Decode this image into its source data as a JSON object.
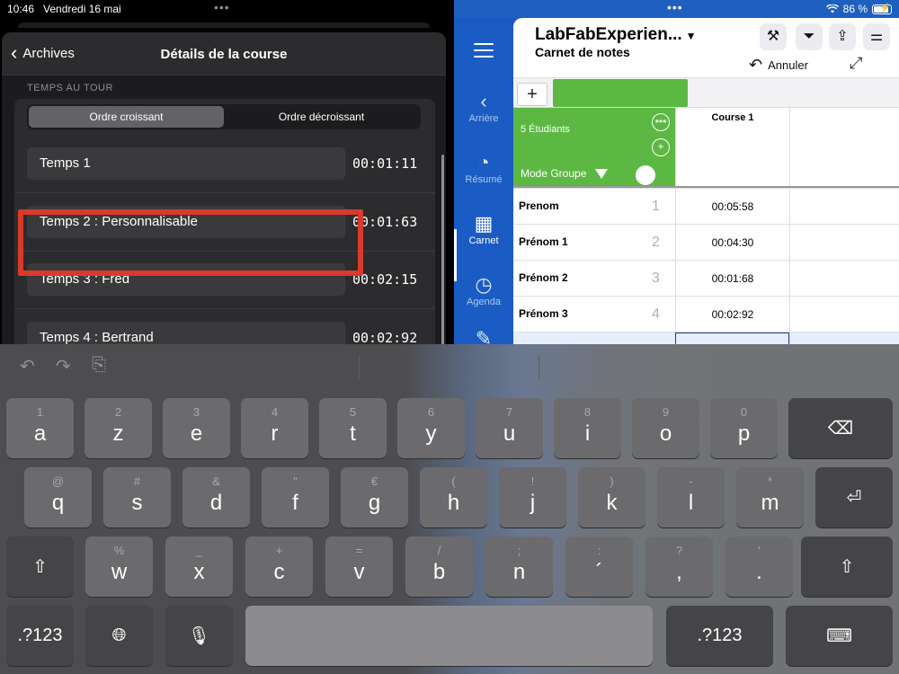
{
  "status_bar": {
    "time": "10:46",
    "date": "Vendredi 16 mai",
    "battery": "86 %"
  },
  "left_pane": {
    "back_label": "Archives",
    "title": "Détails de la course",
    "section_header": "TEMPS AU TOUR",
    "segments": [
      "Ordre croissant",
      "Ordre décroissant"
    ],
    "laps": [
      {
        "label": "Temps 1",
        "time": "00:01:11"
      },
      {
        "label": "Temps 2 : Personnalisable",
        "time": "00:01:63"
      },
      {
        "label": "Temps 3 : Fred",
        "time": "00:02:15"
      },
      {
        "label": "Temps 4 : Bertrand",
        "time": "00:02:92"
      }
    ]
  },
  "right_pane": {
    "sidebar": [
      {
        "label": "Arrière",
        "icon": "chevron-left-icon"
      },
      {
        "label": "Résumé",
        "icon": "pie-chart-icon"
      },
      {
        "label": "Carnet",
        "icon": "grid-icon"
      },
      {
        "label": "Agenda",
        "icon": "clock-icon"
      }
    ],
    "app_title": "LabFabExperien...",
    "app_subtitle": "Carnet de notes",
    "undo_label": "Annuler",
    "group": {
      "count": "5 Étudiants",
      "mode": "Mode Groupe"
    },
    "column_header": "Course 1",
    "rows": [
      {
        "name": "Prenom",
        "num": "1",
        "value": "00:05:58"
      },
      {
        "name": "Prénom 1",
        "num": "2",
        "value": "00:04:30"
      },
      {
        "name": "Prénom 2",
        "num": "3",
        "value": "00:01:68"
      },
      {
        "name": "Prénom 3",
        "num": "4",
        "value": "00:02:92"
      }
    ]
  },
  "keyboard": {
    "row1": [
      {
        "sub": "1",
        "main": "a"
      },
      {
        "sub": "2",
        "main": "z"
      },
      {
        "sub": "3",
        "main": "e"
      },
      {
        "sub": "4",
        "main": "r"
      },
      {
        "sub": "5",
        "main": "t"
      },
      {
        "sub": "6",
        "main": "y"
      },
      {
        "sub": "7",
        "main": "u"
      },
      {
        "sub": "8",
        "main": "i"
      },
      {
        "sub": "9",
        "main": "o"
      },
      {
        "sub": "0",
        "main": "p"
      }
    ],
    "row2": [
      {
        "sub": "@",
        "main": "q"
      },
      {
        "sub": "#",
        "main": "s"
      },
      {
        "sub": "&",
        "main": "d"
      },
      {
        "sub": "\"",
        "main": "f"
      },
      {
        "sub": "€",
        "main": "g"
      },
      {
        "sub": "(",
        "main": "h"
      },
      {
        "sub": "!",
        "main": "j"
      },
      {
        "sub": ")",
        "main": "k"
      },
      {
        "sub": "-",
        "main": "l"
      },
      {
        "sub": "*",
        "main": "m"
      }
    ],
    "row3": [
      {
        "sub": "%",
        "main": "w"
      },
      {
        "sub": "_",
        "main": "x"
      },
      {
        "sub": "+",
        "main": "c"
      },
      {
        "sub": "=",
        "main": "v"
      },
      {
        "sub": "/",
        "main": "b"
      },
      {
        "sub": ";",
        "main": "n"
      },
      {
        "sub": ":",
        "main": "´"
      },
      {
        "sub": "?",
        "main": ","
      },
      {
        "sub": "′",
        "main": "."
      }
    ],
    "numbers_label": ".?123"
  }
}
